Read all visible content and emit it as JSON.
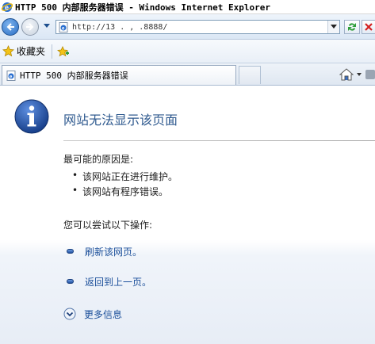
{
  "window": {
    "title": "HTTP 500 内部服务器错误 - Windows Internet Explorer"
  },
  "toolbar": {
    "back_icon": "back-arrow-icon",
    "forward_icon": "forward-arrow-icon",
    "address": "http://13  .  ,  .8888/",
    "refresh_icon": "refresh-icon",
    "stop_icon": "stop-icon"
  },
  "favorites": {
    "label": "收藏夹"
  },
  "tab": {
    "label": "HTTP 500 内部服务器错误"
  },
  "page": {
    "heading": "网站无法显示该页面",
    "causes_title": "最可能的原因是:",
    "causes": [
      "该网站正在进行维护。",
      "该网站有程序错误。"
    ],
    "actions_title": "您可以尝试以下操作:",
    "actions": [
      "刷新该网页。",
      "返回到上一页。"
    ],
    "more_info": "更多信息"
  },
  "colors": {
    "heading": "#2f5a8f",
    "link": "#1b4f9a",
    "info_icon": "#1f4fa0"
  }
}
